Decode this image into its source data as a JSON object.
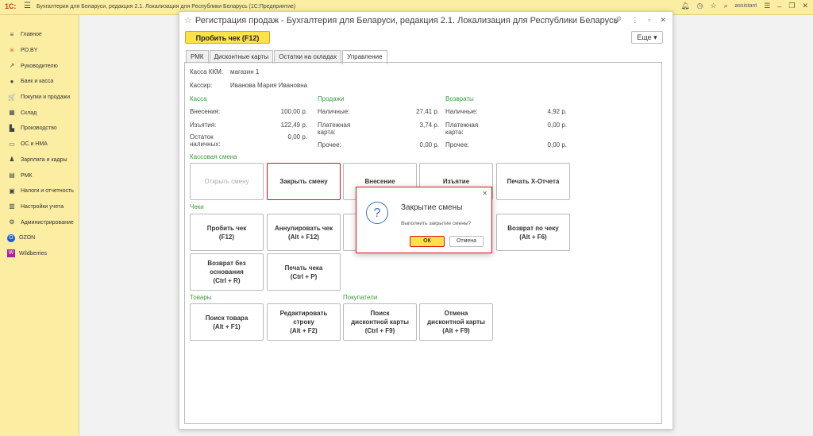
{
  "topbar": {
    "logo": "1С:",
    "menu_icon": "☰",
    "title": "Бухгалтерия для Беларуси, редакция 2.1. Локализация для Республики Беларусь   (1С:Предприятие)",
    "icons": {
      "bell": "bell-icon",
      "history": "history-icon",
      "star": "star-icon",
      "search": "search-icon"
    },
    "user": "assistant",
    "menu": "☰",
    "minimize": "–",
    "restore": "❐",
    "close": "✕"
  },
  "sidebar": {
    "items": [
      {
        "label": "Главное",
        "icon": "≡"
      },
      {
        "label": "PO.BY",
        "icon": "✳"
      },
      {
        "label": "Руководителю",
        "icon": "↗"
      },
      {
        "label": "Банк и касса",
        "icon": "●"
      },
      {
        "label": "Покупки и продажи",
        "icon": "🛒"
      },
      {
        "label": "Склад",
        "icon": "▦"
      },
      {
        "label": "Производство",
        "icon": "▙"
      },
      {
        "label": "ОС и НМА",
        "icon": "▭"
      },
      {
        "label": "Зарплата и кадры",
        "icon": "♟"
      },
      {
        "label": "РМК",
        "icon": "▤"
      },
      {
        "label": "Налоги и отчетность",
        "icon": "▣"
      },
      {
        "label": "Настройки учета",
        "icon": "▥"
      },
      {
        "label": "Администрирование",
        "icon": "⚙"
      },
      {
        "label": "OZON",
        "icon": "O"
      },
      {
        "label": "Wildberries",
        "icon": "W"
      }
    ]
  },
  "window": {
    "title": "Регистрация продаж - Бухгалтерия для Беларуси, редакция 2.1. Локализация для Республики Беларусь",
    "star": "☆",
    "controls": {
      "link": "🔗",
      "more": "⋮",
      "minimize": "▫",
      "close": "✕"
    },
    "main_button": "Пробить чек (F12)",
    "more_button": "Еще ▾",
    "tabs": [
      "РМК",
      "Дисконтные карты",
      "Остатки на складах",
      "Управление"
    ]
  },
  "panel": {
    "kkm_label": "Касса ККМ:",
    "kkm_value": "магазин 1",
    "cashier_label": "Кассир:",
    "cashier_value": "Иванова Мария Ивановна",
    "kassa": {
      "title": "Касса",
      "rows": [
        {
          "label": "Внесения:",
          "value": "100,00 р."
        },
        {
          "label": "Изъятия:",
          "value": "122,49 р."
        },
        {
          "label": "Остаток\nналичных:",
          "value": "0,00 р."
        }
      ]
    },
    "sales": {
      "title": "Продажи",
      "rows": [
        {
          "label": "Наличные:",
          "value": "27,41 р."
        },
        {
          "label": "Платежная\nкарта:",
          "value": "3,74 р."
        },
        {
          "label": "Прочее:",
          "value": "0,00 р."
        }
      ]
    },
    "returns": {
      "title": "Возвраты",
      "rows": [
        {
          "label": "Наличные:",
          "value": "4,92 р."
        },
        {
          "label": "Платежная\nкарта:",
          "value": "0,00 р."
        },
        {
          "label": "Прочее:",
          "value": "0,00 р."
        }
      ]
    },
    "shift": {
      "title": "Кассовая смена",
      "buttons": [
        "Открыть смену",
        "Закрыть смену",
        "Внесение",
        "Изъятие",
        "Печать X-Отчета"
      ]
    },
    "checks": {
      "title": "Чеки",
      "buttons": [
        "Пробить чек\n(F12)",
        "Аннулировать чек\n(Alt + F12)",
        "",
        "Возврат по чеку\n(Alt + F6)",
        "Возврат без\nоснования\n(Ctrl + R)",
        "Печать чека\n(Ctrl + P)"
      ]
    },
    "goods": {
      "title": "Товары",
      "buttons": [
        "Поиск товара\n(Alt + F1)",
        "Редактировать\nстроку\n(Alt + F2)"
      ]
    },
    "buyers": {
      "title": "Покупатели",
      "buttons": [
        "Поиск\nдисконтной карты\n(Ctrl + F9)",
        "Отмена\nдисконтной карты\n(Alt + F9)"
      ]
    }
  },
  "dialog": {
    "title": "Закрытие смены",
    "text": "Выполнить закрытие смены?",
    "ok": "ОК",
    "cancel": "Отмена",
    "icon": "?",
    "close": "✕"
  }
}
